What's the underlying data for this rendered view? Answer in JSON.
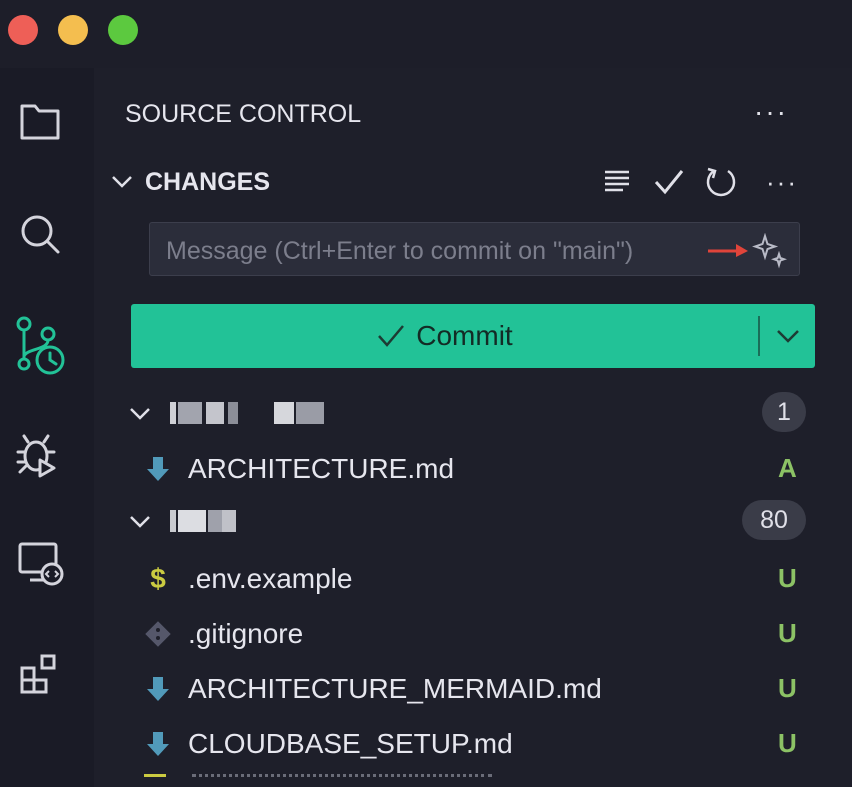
{
  "activity_bar": {
    "items": [
      {
        "icon": "files-icon"
      },
      {
        "icon": "search-icon"
      },
      {
        "icon": "source-control-icon"
      },
      {
        "icon": "debug-icon"
      },
      {
        "icon": "remote-explorer-icon"
      },
      {
        "icon": "extensions-icon"
      }
    ]
  },
  "panel": {
    "title": "SOURCE CONTROL",
    "more_label": "···"
  },
  "changes": {
    "label": "CHANGES",
    "more_label": "···"
  },
  "message": {
    "placeholder": "Message (Ctrl+Enter to commit on \"main\")",
    "value": ""
  },
  "commit": {
    "label": "Commit",
    "check": "✓"
  },
  "colors": {
    "accent": "#22c297",
    "status_added": "#8cc265",
    "status_untracked": "#8cc265",
    "markdown_icon": "#519aba",
    "env_icon": "#cbcb41",
    "git_icon": "#6d6f7c",
    "annotation_arrow": "#e0443a"
  },
  "repos": [
    {
      "name_redacted": true,
      "count": "1",
      "files": [
        {
          "name": "ARCHITECTURE.md",
          "status": "A",
          "icon": "markdown-icon"
        }
      ]
    },
    {
      "name_redacted": true,
      "count": "80",
      "files": [
        {
          "name": ".env.example",
          "status": "U",
          "icon": "env-icon",
          "glyph": "$"
        },
        {
          "name": ".gitignore",
          "status": "U",
          "icon": "git-icon"
        },
        {
          "name": "ARCHITECTURE_MERMAID.md",
          "status": "U",
          "icon": "markdown-icon"
        },
        {
          "name": "CLOUDBASE_SETUP.md",
          "status": "U",
          "icon": "markdown-icon"
        }
      ]
    }
  ]
}
